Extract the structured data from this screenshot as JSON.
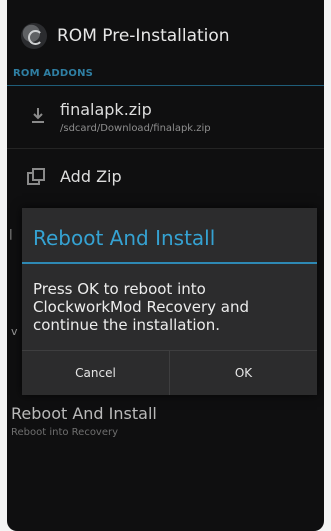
{
  "app": {
    "title": "ROM Pre-Installation",
    "icon": "clockworkmod-icon"
  },
  "section": {
    "addons_header": "ROM ADDONS"
  },
  "items": {
    "zip_file": {
      "name": "finalapk.zip",
      "path": "/sdcard/Download/finalapk.zip",
      "icon": "download-icon"
    },
    "add_zip": {
      "label": "Add Zip",
      "icon": "add-zip-icon"
    },
    "reboot": {
      "title": "Reboot And Install",
      "subtitle": "Reboot into Recovery"
    }
  },
  "dialog": {
    "title": "Reboot And Install",
    "message": "Press OK to reboot into ClockworkMod Recovery and continue the installation.",
    "cancel_label": "Cancel",
    "ok_label": "OK"
  },
  "colors": {
    "accent": "#35a2d2",
    "background": "#0f0f10",
    "dialog": "#2c2c2d"
  }
}
